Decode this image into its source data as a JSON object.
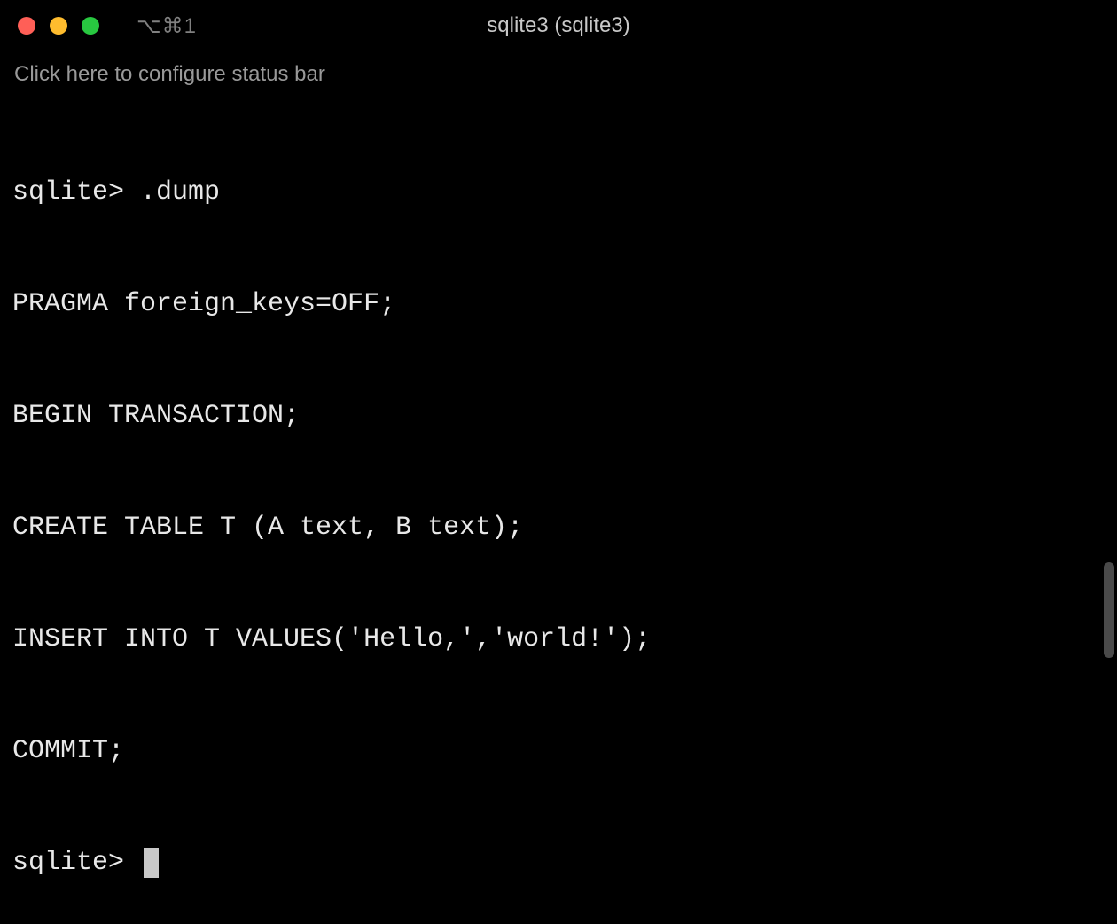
{
  "titlebar": {
    "tab_indicator": "⌥⌘1",
    "title": "sqlite3 (sqlite3)"
  },
  "status_bar": {
    "text": "Click here to configure status bar"
  },
  "terminal": {
    "lines": [
      "sqlite> .dump",
      "PRAGMA foreign_keys=OFF;",
      "BEGIN TRANSACTION;",
      "CREATE TABLE T (A text, B text);",
      "INSERT INTO T VALUES('Hello,','world!');",
      "COMMIT;",
      "sqlite> "
    ]
  }
}
